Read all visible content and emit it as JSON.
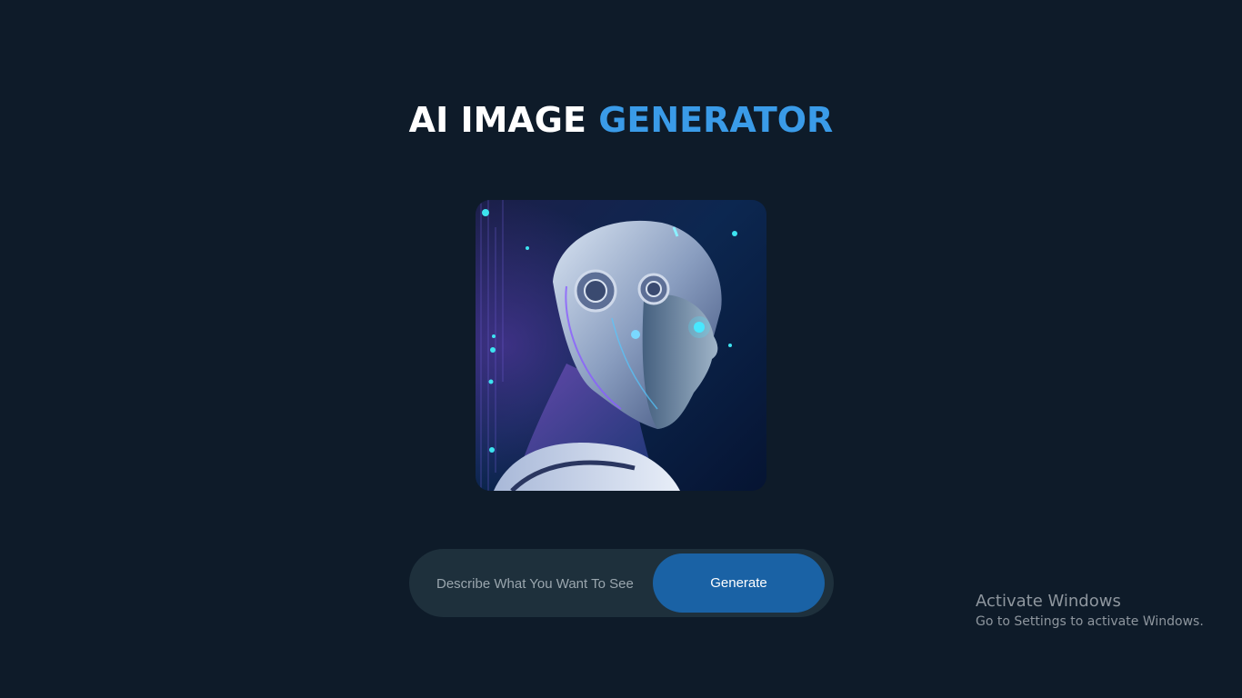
{
  "header": {
    "title_part1": "AI IMAGE",
    "title_part2": "GENERATOR"
  },
  "preview": {
    "image_alt": "AI robot portrait"
  },
  "prompt": {
    "placeholder": "Describe What You Want To See",
    "value": "",
    "button_label": "Generate"
  },
  "watermark": {
    "title": "Activate Windows",
    "subtitle": "Go to Settings to activate Windows."
  },
  "colors": {
    "background": "#0e1b29",
    "accent": "#3a9be8",
    "button": "#1a62a5",
    "prompt_bar": "#1e303c"
  }
}
